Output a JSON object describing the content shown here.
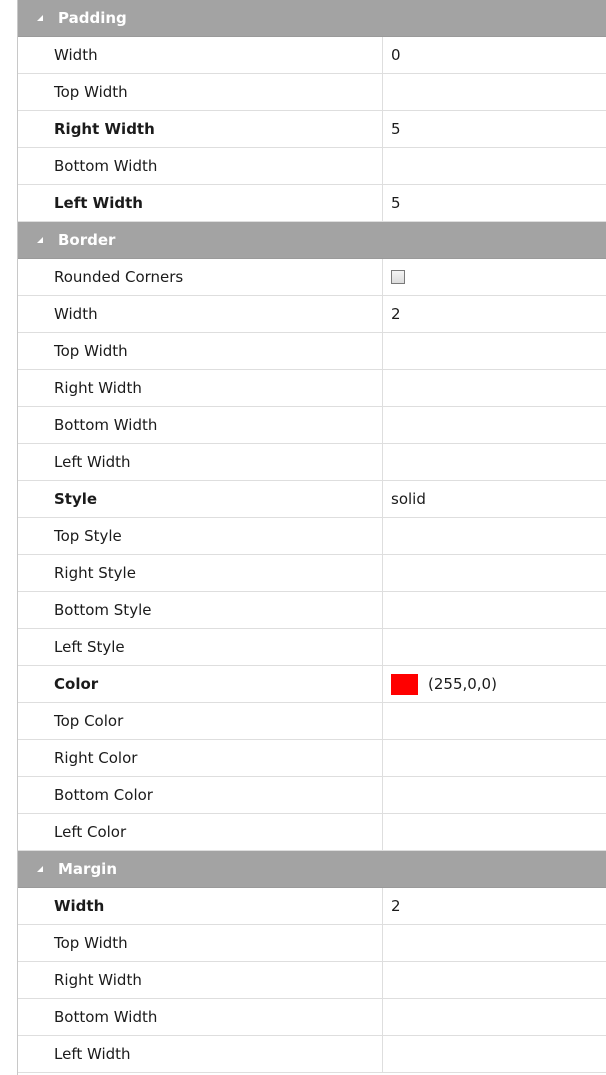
{
  "colors": {
    "header_bg": "#a3a3a3",
    "swatch": "#ff0000"
  },
  "icons": {
    "expander": "collapse-triangle-icon",
    "checkbox": "unchecked-checkbox"
  },
  "sections": [
    {
      "title": "Padding",
      "rows": [
        {
          "name": "Width",
          "value": "0",
          "bold": false
        },
        {
          "name": "Top Width",
          "value": "",
          "bold": false
        },
        {
          "name": "Right Width",
          "value": "5",
          "bold": true
        },
        {
          "name": "Bottom Width",
          "value": "",
          "bold": false
        },
        {
          "name": "Left Width",
          "value": "5",
          "bold": true
        }
      ]
    },
    {
      "title": "Border",
      "rows": [
        {
          "name": "Rounded Corners",
          "value": "",
          "bold": false,
          "type": "checkbox",
          "checked": false
        },
        {
          "name": "Width",
          "value": "2",
          "bold": false
        },
        {
          "name": "Top Width",
          "value": "",
          "bold": false
        },
        {
          "name": "Right Width",
          "value": "",
          "bold": false
        },
        {
          "name": "Bottom Width",
          "value": "",
          "bold": false
        },
        {
          "name": "Left Width",
          "value": "",
          "bold": false
        },
        {
          "name": "Style",
          "value": "solid",
          "bold": true
        },
        {
          "name": "Top Style",
          "value": "",
          "bold": false
        },
        {
          "name": "Right Style",
          "value": "",
          "bold": false
        },
        {
          "name": "Bottom Style",
          "value": "",
          "bold": false
        },
        {
          "name": "Left Style",
          "value": "",
          "bold": false
        },
        {
          "name": "Color",
          "value": "(255,0,0)",
          "bold": true,
          "type": "color",
          "color": "#ff0000"
        },
        {
          "name": "Top Color",
          "value": "",
          "bold": false
        },
        {
          "name": "Right Color",
          "value": "",
          "bold": false
        },
        {
          "name": "Bottom Color",
          "value": "",
          "bold": false
        },
        {
          "name": "Left Color",
          "value": "",
          "bold": false
        }
      ]
    },
    {
      "title": "Margin",
      "rows": [
        {
          "name": "Width",
          "value": "2",
          "bold": true
        },
        {
          "name": "Top Width",
          "value": "",
          "bold": false
        },
        {
          "name": "Right Width",
          "value": "",
          "bold": false
        },
        {
          "name": "Bottom Width",
          "value": "",
          "bold": false
        },
        {
          "name": "Left Width",
          "value": "",
          "bold": false
        }
      ]
    }
  ]
}
